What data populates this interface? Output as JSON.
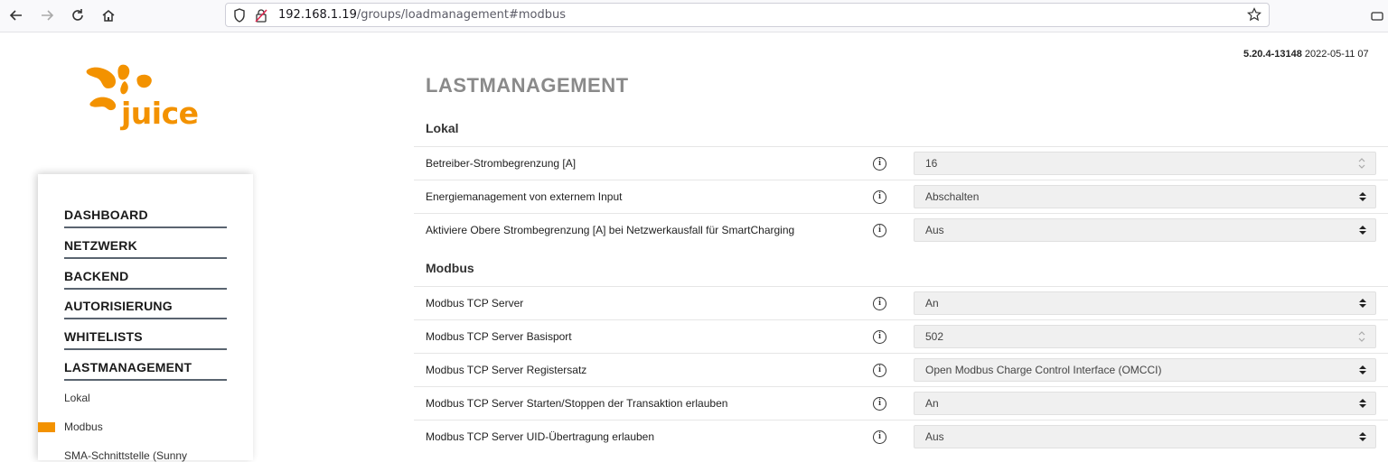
{
  "browser": {
    "url_host": "192.168.1.19",
    "url_path": "/groups/loadmanagement#modbus"
  },
  "brand": {
    "logo_text": "juice",
    "accent_color": "#f39200"
  },
  "sidebar": {
    "items": [
      {
        "label": "DASHBOARD"
      },
      {
        "label": "NETZWERK"
      },
      {
        "label": "BACKEND"
      },
      {
        "label": "AUTORISIERUNG"
      },
      {
        "label": "WHITELISTS"
      },
      {
        "label": "LASTMANAGEMENT"
      }
    ],
    "sub_items": [
      {
        "label": "Lokal"
      },
      {
        "label": "Modbus"
      },
      {
        "label": "SMA-Schnittstelle (Sunny"
      }
    ]
  },
  "header": {
    "version": "5.20.4-13148",
    "date": "2022-05-11 07"
  },
  "main": {
    "title": "LASTMANAGEMENT",
    "sections": [
      {
        "title": "Lokal",
        "rows": [
          {
            "label": "Betreiber-Strombegrenzung [A]",
            "value": "16",
            "control": "number"
          },
          {
            "label": "Energiemanagement von externem Input",
            "value": "Abschalten",
            "control": "select"
          },
          {
            "label": "Aktiviere Obere Strombegrenzung [A] bei Netzwerkausfall für SmartCharging",
            "value": "Aus",
            "control": "select"
          }
        ]
      },
      {
        "title": "Modbus",
        "rows": [
          {
            "label": "Modbus TCP Server",
            "value": "An",
            "control": "select"
          },
          {
            "label": "Modbus TCP Server Basisport",
            "value": "502",
            "control": "number"
          },
          {
            "label": "Modbus TCP Server Registersatz",
            "value": "Open Modbus Charge Control Interface (OMCCI)",
            "control": "select"
          },
          {
            "label": "Modbus TCP Server Starten/Stoppen der Transaktion erlauben",
            "value": "An",
            "control": "select"
          },
          {
            "label": "Modbus TCP Server UID-Übertragung erlauben",
            "value": "Aus",
            "control": "select"
          }
        ]
      }
    ]
  }
}
